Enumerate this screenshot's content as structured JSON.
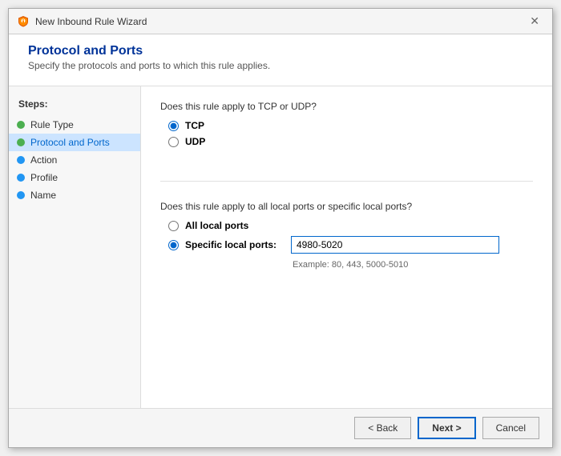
{
  "window": {
    "title": "New Inbound Rule Wizard",
    "close_label": "✕"
  },
  "header": {
    "title": "Protocol and Ports",
    "subtitle": "Specify the protocols and ports to which this rule applies."
  },
  "sidebar": {
    "steps_label": "Steps:",
    "items": [
      {
        "id": "rule-type",
        "label": "Rule Type",
        "state": "completed"
      },
      {
        "id": "protocol-ports",
        "label": "Protocol and Ports",
        "state": "active"
      },
      {
        "id": "action",
        "label": "Action",
        "state": "pending"
      },
      {
        "id": "profile",
        "label": "Profile",
        "state": "pending"
      },
      {
        "id": "name",
        "label": "Name",
        "state": "pending"
      }
    ]
  },
  "main": {
    "protocol_question": "Does this rule apply to TCP or UDP?",
    "tcp_label": "TCP",
    "udp_label": "UDP",
    "ports_question": "Does this rule apply to all local ports or specific local ports?",
    "all_ports_label": "All local ports",
    "specific_ports_label": "Specific local ports:",
    "port_value": "4980-5020",
    "port_placeholder": "4980-5020",
    "example_text": "Example: 80, 443, 5000-5010"
  },
  "footer": {
    "back_label": "< Back",
    "next_label": "Next >",
    "cancel_label": "Cancel"
  }
}
